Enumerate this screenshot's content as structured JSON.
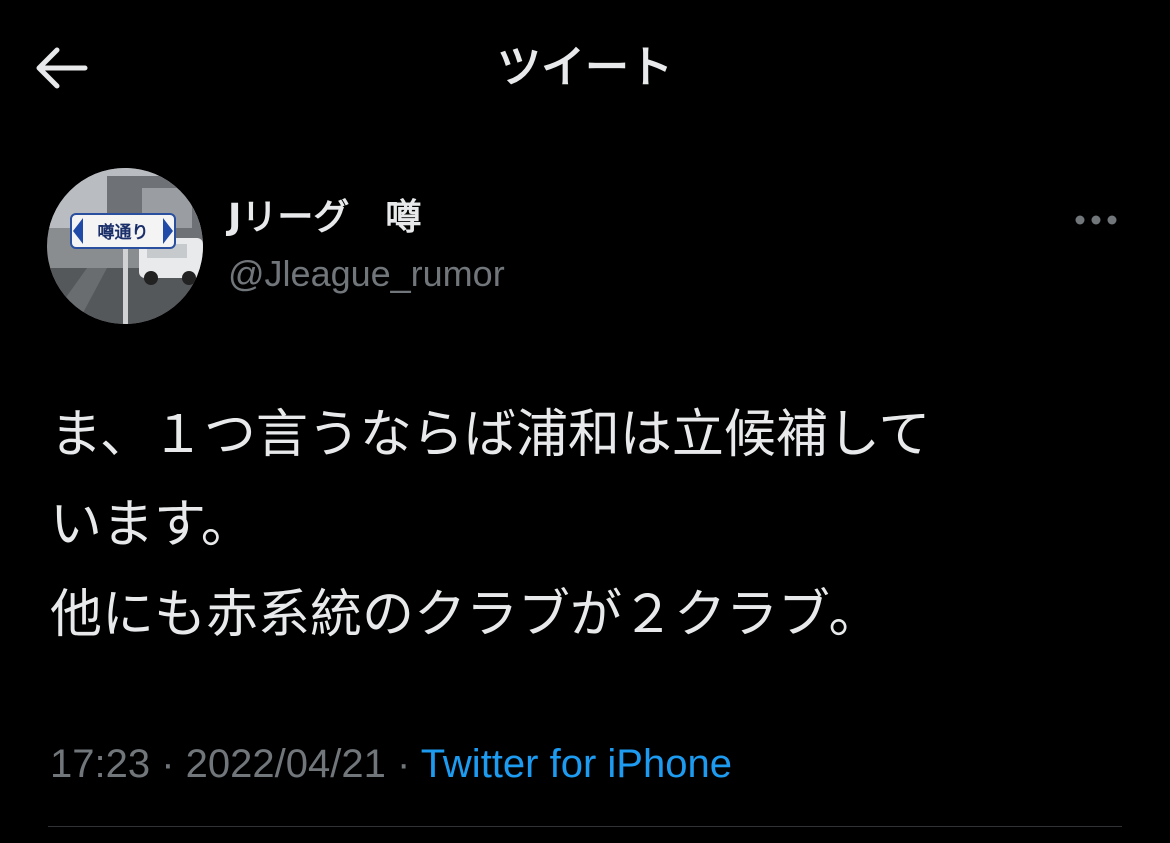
{
  "header": {
    "title": "ツイート",
    "back_icon": "arrow-left-icon"
  },
  "author": {
    "display_name": "Jリーグ　噂",
    "handle": "@Jleague_rumor",
    "avatar_sign_text": "噂通り",
    "more_icon": "more-horizontal-icon"
  },
  "tweet": {
    "lines": [
      "ま、１つ言うならば浦和は立候補して",
      "います。",
      "他にも赤系統のクラブが２クラブ。"
    ]
  },
  "meta": {
    "time": "17:23",
    "separator": " · ",
    "date": "2022/04/21",
    "source": "Twitter for iPhone"
  },
  "colors": {
    "background": "#000000",
    "text_primary": "#e7e9ea",
    "text_secondary": "#71767b",
    "link": "#1d9bf0"
  }
}
